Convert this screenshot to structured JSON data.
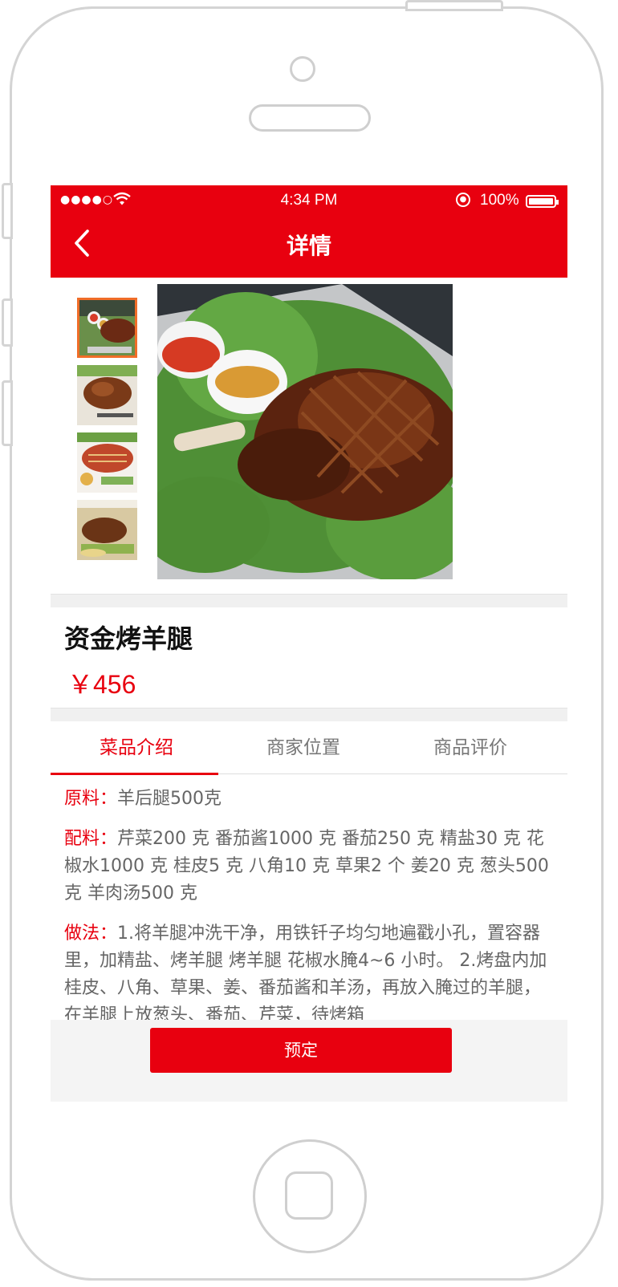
{
  "status_bar": {
    "time": "4:34 PM",
    "battery": "100%",
    "signal": "●●●●○"
  },
  "header": {
    "title": "详情"
  },
  "product": {
    "name": "资金烤羊腿",
    "price": "￥456"
  },
  "tabs": [
    {
      "label": "菜品介绍"
    },
    {
      "label": "商家位置"
    },
    {
      "label": "商品评价"
    }
  ],
  "description": {
    "ingredients": {
      "label": "原料：",
      "text": "羊后腿500克"
    },
    "seasoning": {
      "label": "配料：",
      "text": "芹菜200 克 番茄酱1000 克 番茄250 克 精盐30 克 花椒水1000 克 桂皮5 克 八角10 克 草果2 个 姜20 克 葱头500 克 羊肉汤500 克"
    },
    "method": {
      "label": "做法：",
      "text": "1.将羊腿冲洗干净，用铁钎子均匀地遍戳小孔，置容器里，加精盐、烤羊腿 烤羊腿 花椒水腌4~6 小时。 2.烤盘内加桂皮、八角、草果、姜、番茄酱和羊汤，再放入腌过的羊腿，在羊腿上放葱头、番茄、芹菜，待烤箱"
    }
  },
  "footer": {
    "book_label": "预定"
  },
  "colors": {
    "brand": "#e8000f",
    "thumb_selected": "#f06d28"
  }
}
